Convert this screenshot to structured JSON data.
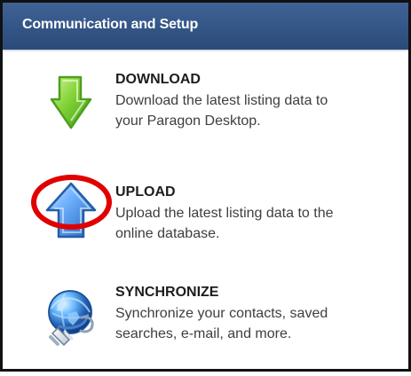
{
  "header": {
    "title": "Communication and Setup"
  },
  "colors": {
    "header": "#345687",
    "download_arrow": "#6ccf24",
    "upload_arrow": "#3b86d6",
    "highlight": "#e10000"
  },
  "items": [
    {
      "title": "DOWNLOAD",
      "description_lines": [
        "Download the latest listing data to",
        "your Paragon Desktop."
      ],
      "icon": "download-arrow-icon"
    },
    {
      "title": "UPLOAD",
      "description_lines": [
        "Upload the latest listing data to the",
        "online database."
      ],
      "icon": "upload-arrow-icon"
    },
    {
      "title": "SYNCHRONIZE",
      "description_lines": [
        "Synchronize your contacts, saved",
        "searches, e-mail, and more."
      ],
      "icon": "sync-globe-icon"
    }
  ]
}
